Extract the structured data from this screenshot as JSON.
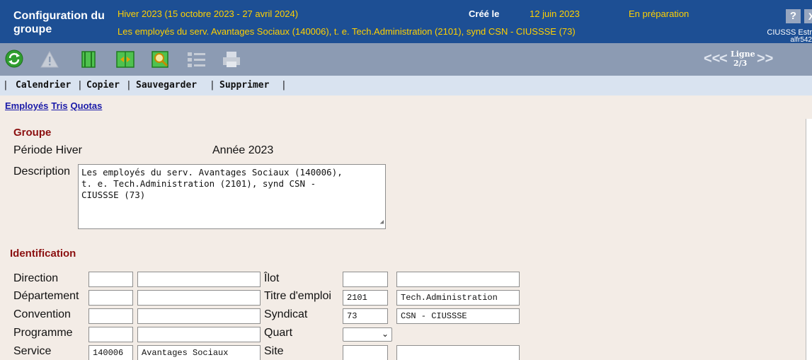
{
  "header": {
    "title": "Configuration du groupe",
    "period": "Hiver 2023 (15 octobre 2023 - 27 avril 2024)",
    "created_label": "Créé le",
    "created_date": "12 juin 2023",
    "status": "En préparation",
    "description": "Les employés du serv. Avantages Sociaux (140006), t. e. Tech.Administration (2101), synd CSN - CIUSSSE (73)",
    "help_label": "?",
    "close_label": "X",
    "organization": "CIUSSS Estr",
    "user": "alfr542"
  },
  "toolbar": {
    "icons": [
      "refresh-icon",
      "warning-icon",
      "book-icon",
      "compare-icon",
      "search-icon",
      "checklist-icon",
      "print-icon"
    ],
    "prev_label": "<<",
    "prev_single_label": "<",
    "ligne_label": "Ligne",
    "ligne_value": "2/3",
    "next_label": ">>"
  },
  "menu": {
    "items": [
      "Calendrier",
      "Copier",
      "Sauvegarder",
      "Supprimer"
    ]
  },
  "links": [
    "Employés",
    "Tris",
    "Quotas"
  ],
  "groupe": {
    "heading": "Groupe",
    "periode_label": "Période Hiver",
    "annee_label": "Année 2023",
    "description_label": "Description",
    "description_value": "Les employés du serv. Avantages Sociaux (140006),\nt. e. Tech.Administration (2101), synd CSN -\nCIUSSSE (73)"
  },
  "identification": {
    "heading": "Identification",
    "left": [
      {
        "label": "Direction",
        "code": "",
        "name": ""
      },
      {
        "label": "Département",
        "code": "",
        "name": ""
      },
      {
        "label": "Convention",
        "code": "",
        "name": ""
      },
      {
        "label": "Programme",
        "code": "",
        "name": ""
      },
      {
        "label": "Service",
        "code": "140006",
        "name": "Avantages Sociaux"
      }
    ],
    "right": [
      {
        "label": "Îlot",
        "code": "",
        "name": ""
      },
      {
        "label": "Titre d'emploi",
        "code": "2101",
        "name": "Tech.Administration"
      },
      {
        "label": "Syndicat",
        "code": "73",
        "name": "CSN - CIUSSSE"
      },
      {
        "label": "Quart",
        "selected": ""
      },
      {
        "label": "Site",
        "code": "",
        "name": ""
      }
    ]
  },
  "colors": {
    "header_bg": "#1d4f94",
    "header_accent": "#ffd000",
    "toolbar_bg": "#8c9bb3",
    "menubar_bg": "#d9e3f0",
    "section_heading": "#8b1010",
    "link": "#1a1aa8",
    "page_bg": "#f3ece6"
  }
}
